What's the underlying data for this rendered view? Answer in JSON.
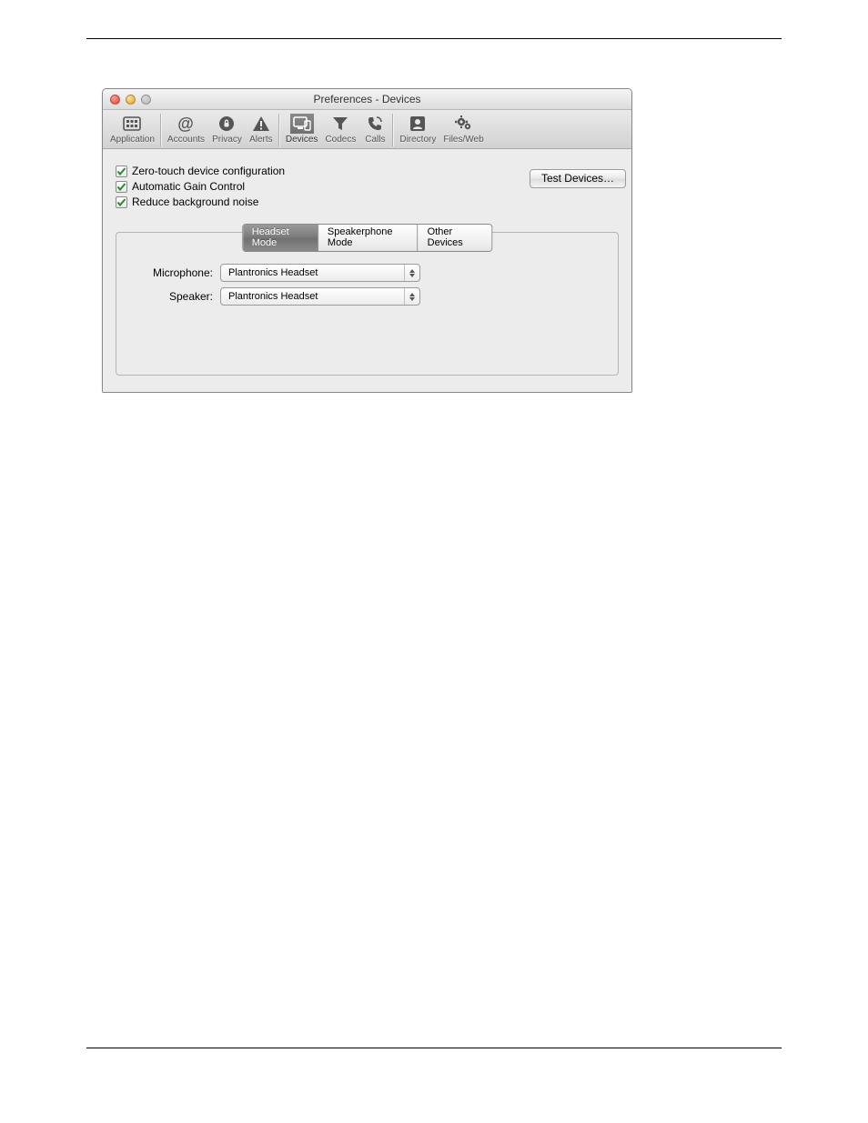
{
  "window": {
    "title": "Preferences - Devices"
  },
  "toolbar": {
    "items": [
      {
        "label": "Application"
      },
      {
        "label": "Accounts"
      },
      {
        "label": "Privacy"
      },
      {
        "label": "Alerts"
      },
      {
        "label": "Devices"
      },
      {
        "label": "Codecs"
      },
      {
        "label": "Calls"
      },
      {
        "label": "Directory"
      },
      {
        "label": "Files/Web"
      }
    ]
  },
  "checkboxes": {
    "zero_touch": {
      "label": "Zero-touch device configuration",
      "checked": true
    },
    "agc": {
      "label": "Automatic Gain Control",
      "checked": true
    },
    "noise": {
      "label": "Reduce background noise",
      "checked": true
    }
  },
  "buttons": {
    "test_devices": "Test Devices…"
  },
  "tabs": {
    "headset": "Headset Mode",
    "speaker": "Speakerphone Mode",
    "other": "Other Devices"
  },
  "form": {
    "microphone_label": "Microphone:",
    "speaker_label": "Speaker:",
    "microphone_value": "Plantronics Headset",
    "speaker_value": "Plantronics Headset"
  }
}
